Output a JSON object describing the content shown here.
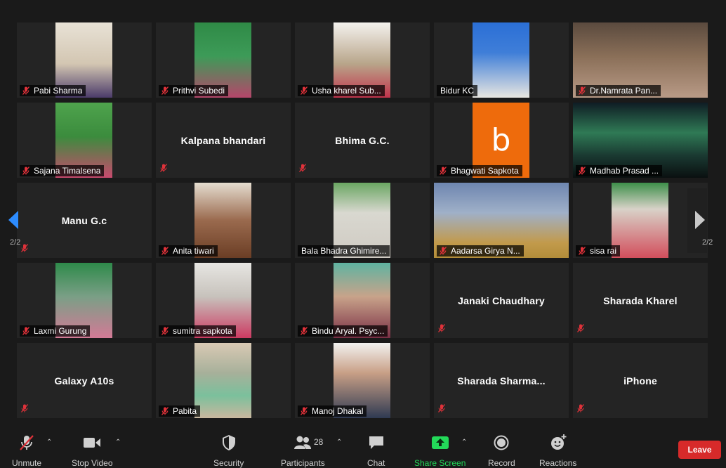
{
  "participants": [
    {
      "name": "Pabi Sharma",
      "muted": true,
      "video": "cam",
      "bg": "linear-gradient(180deg,#e8e2d6 0%,#d3c6b2 55%,#4b3b6a 100%)"
    },
    {
      "name": "Prithvi Subedi",
      "muted": true,
      "video": "cam",
      "bg": "linear-gradient(180deg,#2f8a46 0%,#3d9b58 45%,#b5466a 100%)"
    },
    {
      "name": "Usha kharel Sub...",
      "muted": true,
      "video": "cam",
      "bg": "linear-gradient(180deg,#f4f2ee 0%,#b8a58a 55%,#c2334c 100%)"
    },
    {
      "name": "Bidur KC",
      "muted": false,
      "video": "cam",
      "bg": "linear-gradient(180deg,#2b6fd6 0%,#3f7ed8 40%,#e8e6e1 100%)"
    },
    {
      "name": "Dr.Namrata Pan...",
      "muted": true,
      "video": "wide",
      "bg": "linear-gradient(180deg,#5a4a3e 0%,#8a6f58 45%,#b89a86 100%)"
    },
    {
      "name": "Sajana Timalsena",
      "muted": true,
      "video": "cam",
      "bg": "linear-gradient(180deg,#4fa34d 0%,#3b8c3d 45%,#c94a6e 100%)"
    },
    {
      "name": "Kalpana bhandari",
      "muted": true,
      "video": "none"
    },
    {
      "name": "Bhima G.C.",
      "muted": true,
      "video": "none"
    },
    {
      "name": "Bhagwati Sapkota",
      "muted": true,
      "video": "avatar",
      "avatar_letter": "b",
      "avatar_color": "#ee6b0c"
    },
    {
      "name": "Madhab Prasad ...",
      "muted": true,
      "video": "wide",
      "bg": "linear-gradient(180deg,#0f1c24 0%,#2f7a55 40%,#1a3a32 70%,#0a1010 100%)"
    },
    {
      "name": "Manu G.c",
      "muted": true,
      "video": "none"
    },
    {
      "name": "Anita tiwari",
      "muted": true,
      "video": "cam",
      "bg": "linear-gradient(180deg,#e5ddd0 0%,#9a6a4e 50%,#6b3e25 100%)"
    },
    {
      "name": "Bala Bhadra Ghimire...",
      "muted": false,
      "video": "cam",
      "bg": "linear-gradient(180deg,#6aa662 0%,#d9d8d0 40%,#cfcac2 100%)"
    },
    {
      "name": "Aadarsa Girya N...",
      "muted": true,
      "video": "wide",
      "bg": "linear-gradient(180deg,#6e86b0 0%,#9fb0c8 40%,#c29a4b 80%,#b38d3a 100%)"
    },
    {
      "name": "sisa rai",
      "muted": true,
      "video": "cam",
      "bg": "linear-gradient(180deg,#3d8f4a 0%,#d8d2c8 35%,#d24e5c 100%)"
    },
    {
      "name": "Laxmi Gurung",
      "muted": true,
      "video": "cam",
      "bg": "linear-gradient(180deg,#2e8a4a 0%,#7a9f86 45%,#d37a96 100%)"
    },
    {
      "name": "sumitra sapkota",
      "muted": true,
      "video": "cam",
      "bg": "linear-gradient(180deg,#e7e6e2 0%,#c7c2bc 45%,#cc3a62 100%)"
    },
    {
      "name": "Bindu Aryal. Psyc...",
      "muted": true,
      "video": "cam",
      "bg": "linear-gradient(180deg,#5fb3a1 0%,#c8a38a 45%,#7a2f45 100%)"
    },
    {
      "name": "Janaki Chaudhary",
      "muted": true,
      "video": "none"
    },
    {
      "name": "Sharada  Kharel",
      "muted": true,
      "video": "none"
    },
    {
      "name": "Galaxy A10s",
      "muted": true,
      "video": "none"
    },
    {
      "name": "Pabita",
      "muted": true,
      "video": "cam",
      "bg": "linear-gradient(180deg,#d9c9b4 0%,#a7b09a 40%,#7bc09c 70%,#c9b79e 100%)"
    },
    {
      "name": "Manoj Dhakal",
      "muted": true,
      "video": "cam",
      "bg": "linear-gradient(180deg,#f2f2f0 0%,#c89f86 40%,#2f3a52 100%)"
    },
    {
      "name": "Sharada  Sharma...",
      "muted": true,
      "video": "none"
    },
    {
      "name": "iPhone",
      "muted": true,
      "video": "none"
    }
  ],
  "pagination": {
    "left": "2/2",
    "right": "2/2"
  },
  "toolbar": {
    "unmute": "Unmute",
    "stop_video": "Stop Video",
    "security": "Security",
    "participants": "Participants",
    "participants_count": "28",
    "chat": "Chat",
    "share_screen": "Share Screen",
    "record": "Record",
    "reactions": "Reactions",
    "leave": "Leave"
  },
  "colors": {
    "accent_blue": "#2d8cff",
    "share_green": "#23d959",
    "leave_red": "#d72a2a",
    "mute_red": "#e0323a"
  }
}
